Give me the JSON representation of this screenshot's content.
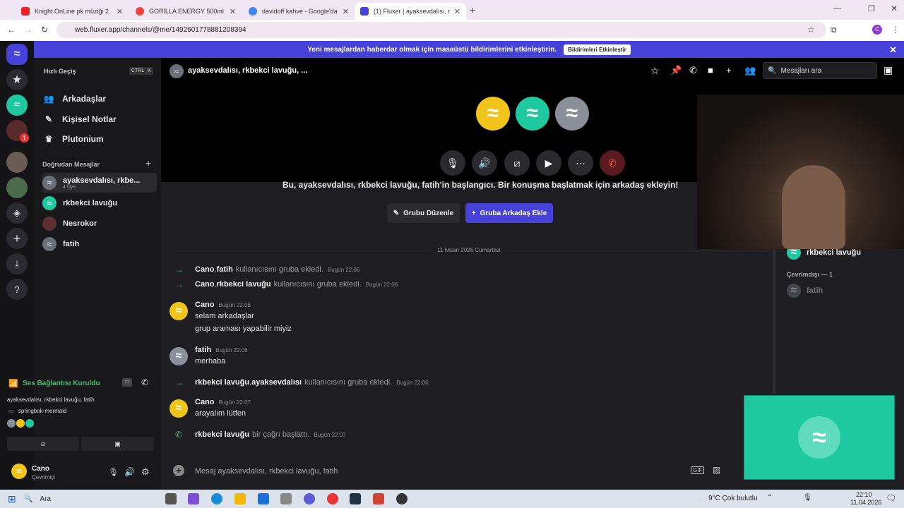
{
  "browser": {
    "tabs": [
      {
        "title": "Knight OnLine pk müziği 2. - Yo",
        "color": "#e22"
      },
      {
        "title": "GORİLLA ENERGY 500ml X12 En",
        "color": "#e44"
      },
      {
        "title": "davidoff kahve - Google'da Ara",
        "color": "#4285f4"
      },
      {
        "title": "(1) Fluxer | ayaksevdalısı, rkb",
        "color": "#4641d9"
      }
    ],
    "url": "web.fluxer.app/channels/@me/1492601778881208394"
  },
  "banner": {
    "text": "Yeni mesajlardan haberdar olmak için masaüstü bildirimlerini etkinleştirin.",
    "button": "Bildirimleri Etkinleştir"
  },
  "sidebar": {
    "quick_switch": "Hızlı Geçiş",
    "shortcut_1": "CTRL",
    "shortcut_2": "K",
    "nav": {
      "friends": "Arkadaşlar",
      "notes": "Kişisel Notlar",
      "plutonium": "Plutonium"
    },
    "dm_header": "Doğrudan Mesajlar",
    "dms": [
      {
        "name": "ayaksevdalısı, rkbe...",
        "sub": "4 Üye"
      },
      {
        "name": "rkbekci lavuğu"
      },
      {
        "name": "Nesrokor"
      },
      {
        "name": "fatih"
      }
    ],
    "voice": {
      "status": "Ses Bağlantısı Kuruldu",
      "members": "ayaksevdalısı, rkbekci lavuğu, fatih",
      "device": "springbok-mermaid"
    },
    "user": {
      "name": "Cano",
      "status": "Çevrimiçi"
    },
    "guild_badge": "1"
  },
  "channel": {
    "title": "ayaksevdalısı, rkbekci lavuğu, ...",
    "search_placeholder": "Mesajları ara"
  },
  "intro": {
    "text": "Bu, ayaksevdalısı, rkbekci lavuğu, fatih'in başlangıcı. Bir konuşma başlatmak için arkadaş ekleyin!",
    "edit_button": "Grubu Düzenle",
    "add_button": "Gruba Arkadaş Ekle"
  },
  "date_divider": "11 Nisan 2026 Cumartesi",
  "messages": {
    "sys1": {
      "a": "Cano",
      "b": "fatih",
      "text": "kullanıcısını gruba ekledi.",
      "time": "Bugün 22:06"
    },
    "sys2": {
      "a": "Cano",
      "b": "rkbekci lavuğu",
      "text": "kullanıcısını gruba ekledi.",
      "time": "Bugün 22:06"
    },
    "m1": {
      "author": "Cano",
      "time": "Bugün 22:06",
      "line1": "selam arkadaşlar",
      "line2": "grup araması yapabilir miyiz"
    },
    "m2": {
      "author": "fatih",
      "time": "Bugün 22:06",
      "line1": "merhaba"
    },
    "sys3": {
      "a": "rkbekci lavuğu",
      "b": "ayaksevdalısı",
      "text": "kullanıcısını gruba ekledi.",
      "time": "Bugün 22:06"
    },
    "m3": {
      "author": "Cano",
      "time": "Bugün 22:07",
      "line1": "arayalım lütfen"
    },
    "sys4": {
      "a": "rkbekci lavuğu",
      "text": "bir çağrı başlattı.",
      "time": "Bugün 22:07"
    }
  },
  "composer_placeholder": "Mesaj ayaksevdalısı, rkbekci lavuğu, fatih",
  "members": {
    "online_name": "rkbekci lavuğu",
    "offline_header": "Çevrimdışı — 1",
    "offline_name": "fatih"
  },
  "taskbar": {
    "search": "Ara",
    "weather": "9°C  Çok bulutlu",
    "time": "22:10",
    "date": "11.04.2026"
  },
  "colors": {
    "accent": "#4641d9",
    "yellow_avatar": "#f0c419",
    "teal_avatar": "#1ec9a0",
    "gray_avatar": "#8a8f99"
  }
}
